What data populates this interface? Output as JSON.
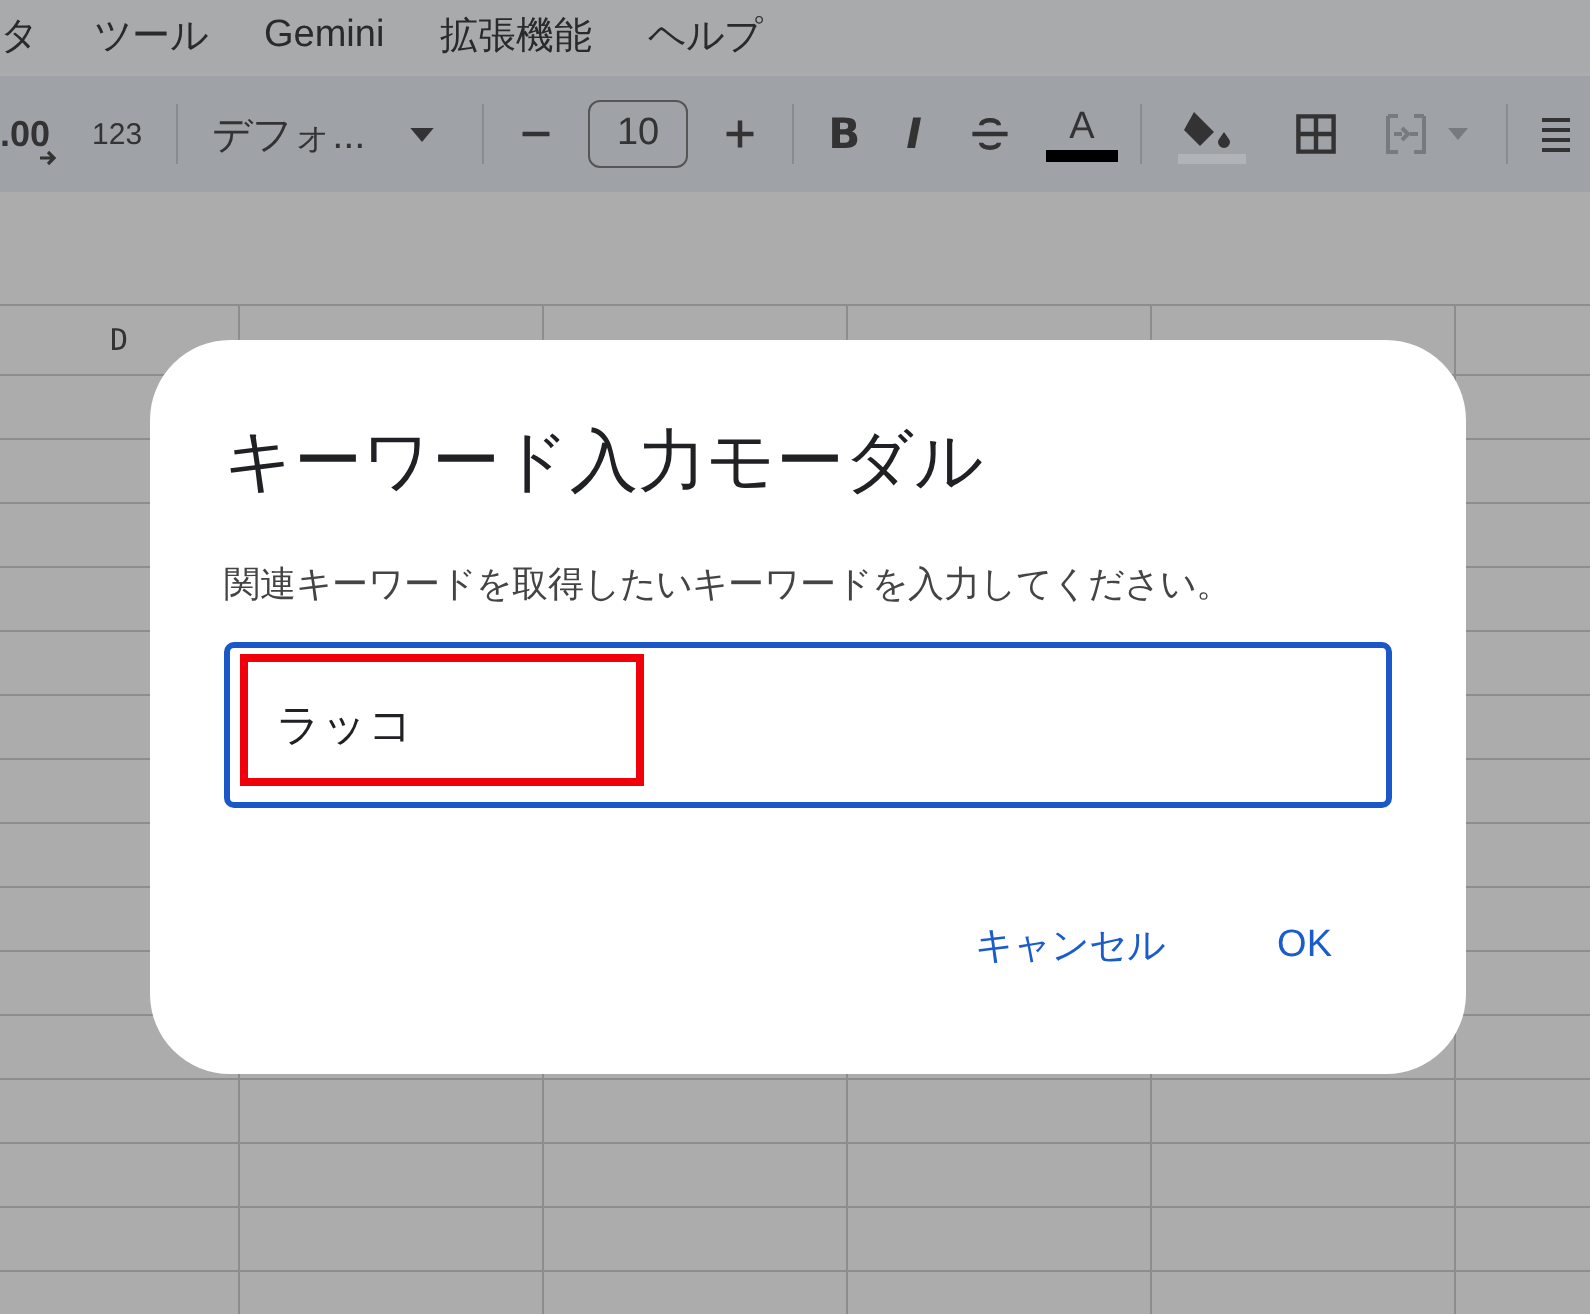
{
  "menu": [
    "タ",
    "ツール",
    "Gemini",
    "拡張機能",
    "ヘルプ"
  ],
  "toolbar": [
    {
      "kind": "decimal",
      "text": ".00"
    },
    {
      "kind": "label",
      "text": "123"
    },
    {
      "kind": "divider"
    },
    {
      "kind": "font",
      "text": "デフォ..."
    },
    {
      "kind": "divider"
    },
    {
      "kind": "minus"
    },
    {
      "kind": "size",
      "text": "10"
    },
    {
      "kind": "plus"
    },
    {
      "kind": "divider"
    },
    {
      "kind": "bold",
      "text": "B"
    },
    {
      "kind": "italic",
      "text": "I"
    },
    {
      "kind": "strike"
    },
    {
      "kind": "text-color",
      "text": "A"
    },
    {
      "kind": "divider"
    },
    {
      "kind": "fill"
    },
    {
      "kind": "borders"
    },
    {
      "kind": "merge",
      "disabled": true
    },
    {
      "kind": "divider"
    },
    {
      "kind": "align"
    }
  ],
  "sheet": {
    "columns": [
      "D",
      "",
      "",
      "",
      "",
      ""
    ]
  },
  "dialog": {
    "title": "キーワード入力モーダル",
    "message": "関連キーワードを取得したいキーワードを入力してください。",
    "input": {
      "value": "ラッコ",
      "highlighted": true
    },
    "buttons": [
      "キャンセル",
      "OK"
    ]
  }
}
